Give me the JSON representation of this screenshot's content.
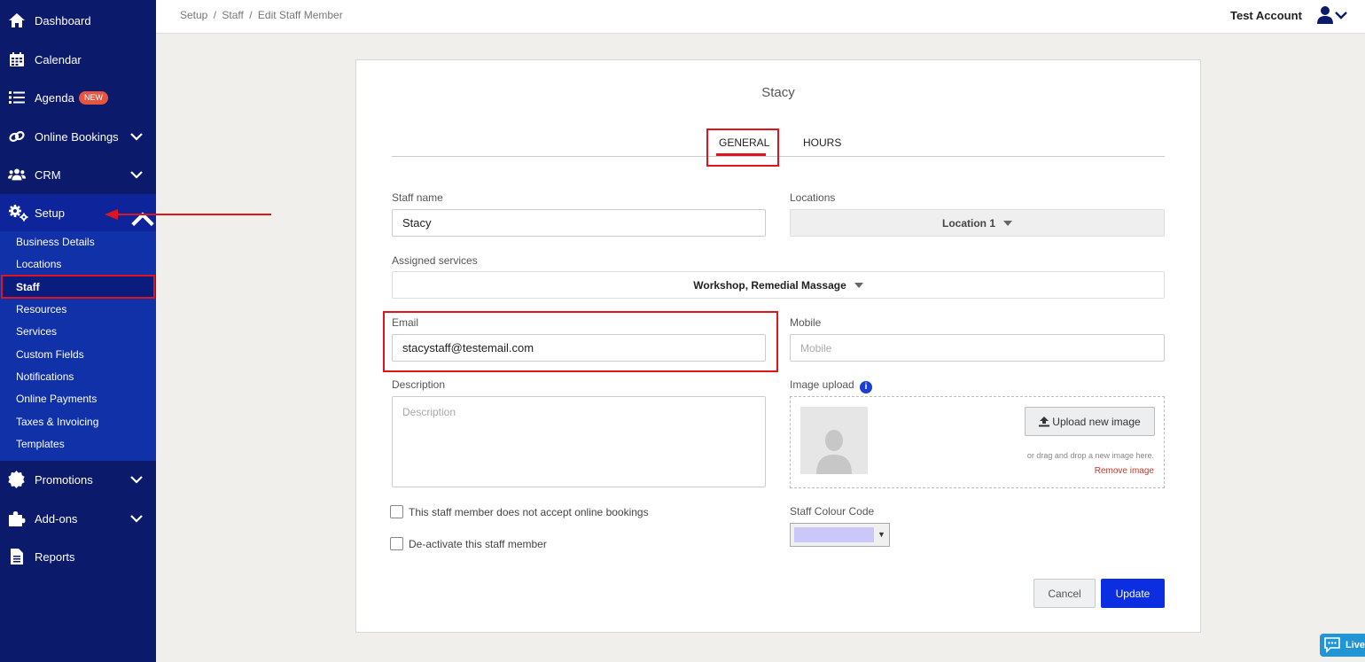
{
  "sidebar": {
    "items": [
      {
        "label": "Dashboard",
        "icon": "home-icon"
      },
      {
        "label": "Calendar",
        "icon": "calendar-icon"
      },
      {
        "label": "Agenda",
        "icon": "list-icon",
        "badge": "NEW"
      },
      {
        "label": "Online Bookings",
        "icon": "link-icon"
      },
      {
        "label": "CRM",
        "icon": "users-icon"
      },
      {
        "label": "Setup",
        "icon": "gears-icon"
      },
      {
        "label": "Promotions",
        "icon": "badge-icon"
      },
      {
        "label": "Add-ons",
        "icon": "puzzle-icon"
      },
      {
        "label": "Reports",
        "icon": "document-icon"
      }
    ],
    "setup_submenu": [
      "Business Details",
      "Locations",
      "Staff",
      "Resources",
      "Services",
      "Custom Fields",
      "Notifications",
      "Online Payments",
      "Taxes & Invoicing",
      "Templates"
    ],
    "active_subitem": "Staff"
  },
  "header": {
    "breadcrumb": [
      "Setup",
      "/",
      "Staff",
      "/",
      "Edit Staff Member"
    ],
    "account_name": "Test Account"
  },
  "form": {
    "title": "Stacy",
    "tabs": [
      "GENERAL",
      "HOURS"
    ],
    "active_tab": "GENERAL",
    "staff_name_label": "Staff name",
    "staff_name_value": "Stacy",
    "locations_label": "Locations",
    "locations_value": "Location 1",
    "assigned_services_label": "Assigned services",
    "assigned_services_value": "Workshop, Remedial Massage",
    "email_label": "Email",
    "email_value": "stacystaff@testemail.com",
    "mobile_label": "Mobile",
    "mobile_placeholder": "Mobile",
    "description_label": "Description",
    "description_placeholder": "Description",
    "image_upload_label": "Image upload",
    "upload_button": "Upload new image",
    "drag_hint": "or drag and drop a new image here.",
    "remove_image": "Remove image",
    "no_online_bookings_label": "This staff member does not accept online bookings",
    "deactivate_label": "De-activate this staff member",
    "colour_code_label": "Staff Colour Code",
    "colour_value": "#c9c8f8",
    "cancel_button": "Cancel",
    "update_button": "Update"
  },
  "live_chat": "Live",
  "colors": {
    "sidebar_bg": "#0b1a6b",
    "submenu_bg": "#1131a8",
    "primary": "#0b2fe0",
    "highlight": "#e0141c",
    "badge": "#e8553e"
  }
}
